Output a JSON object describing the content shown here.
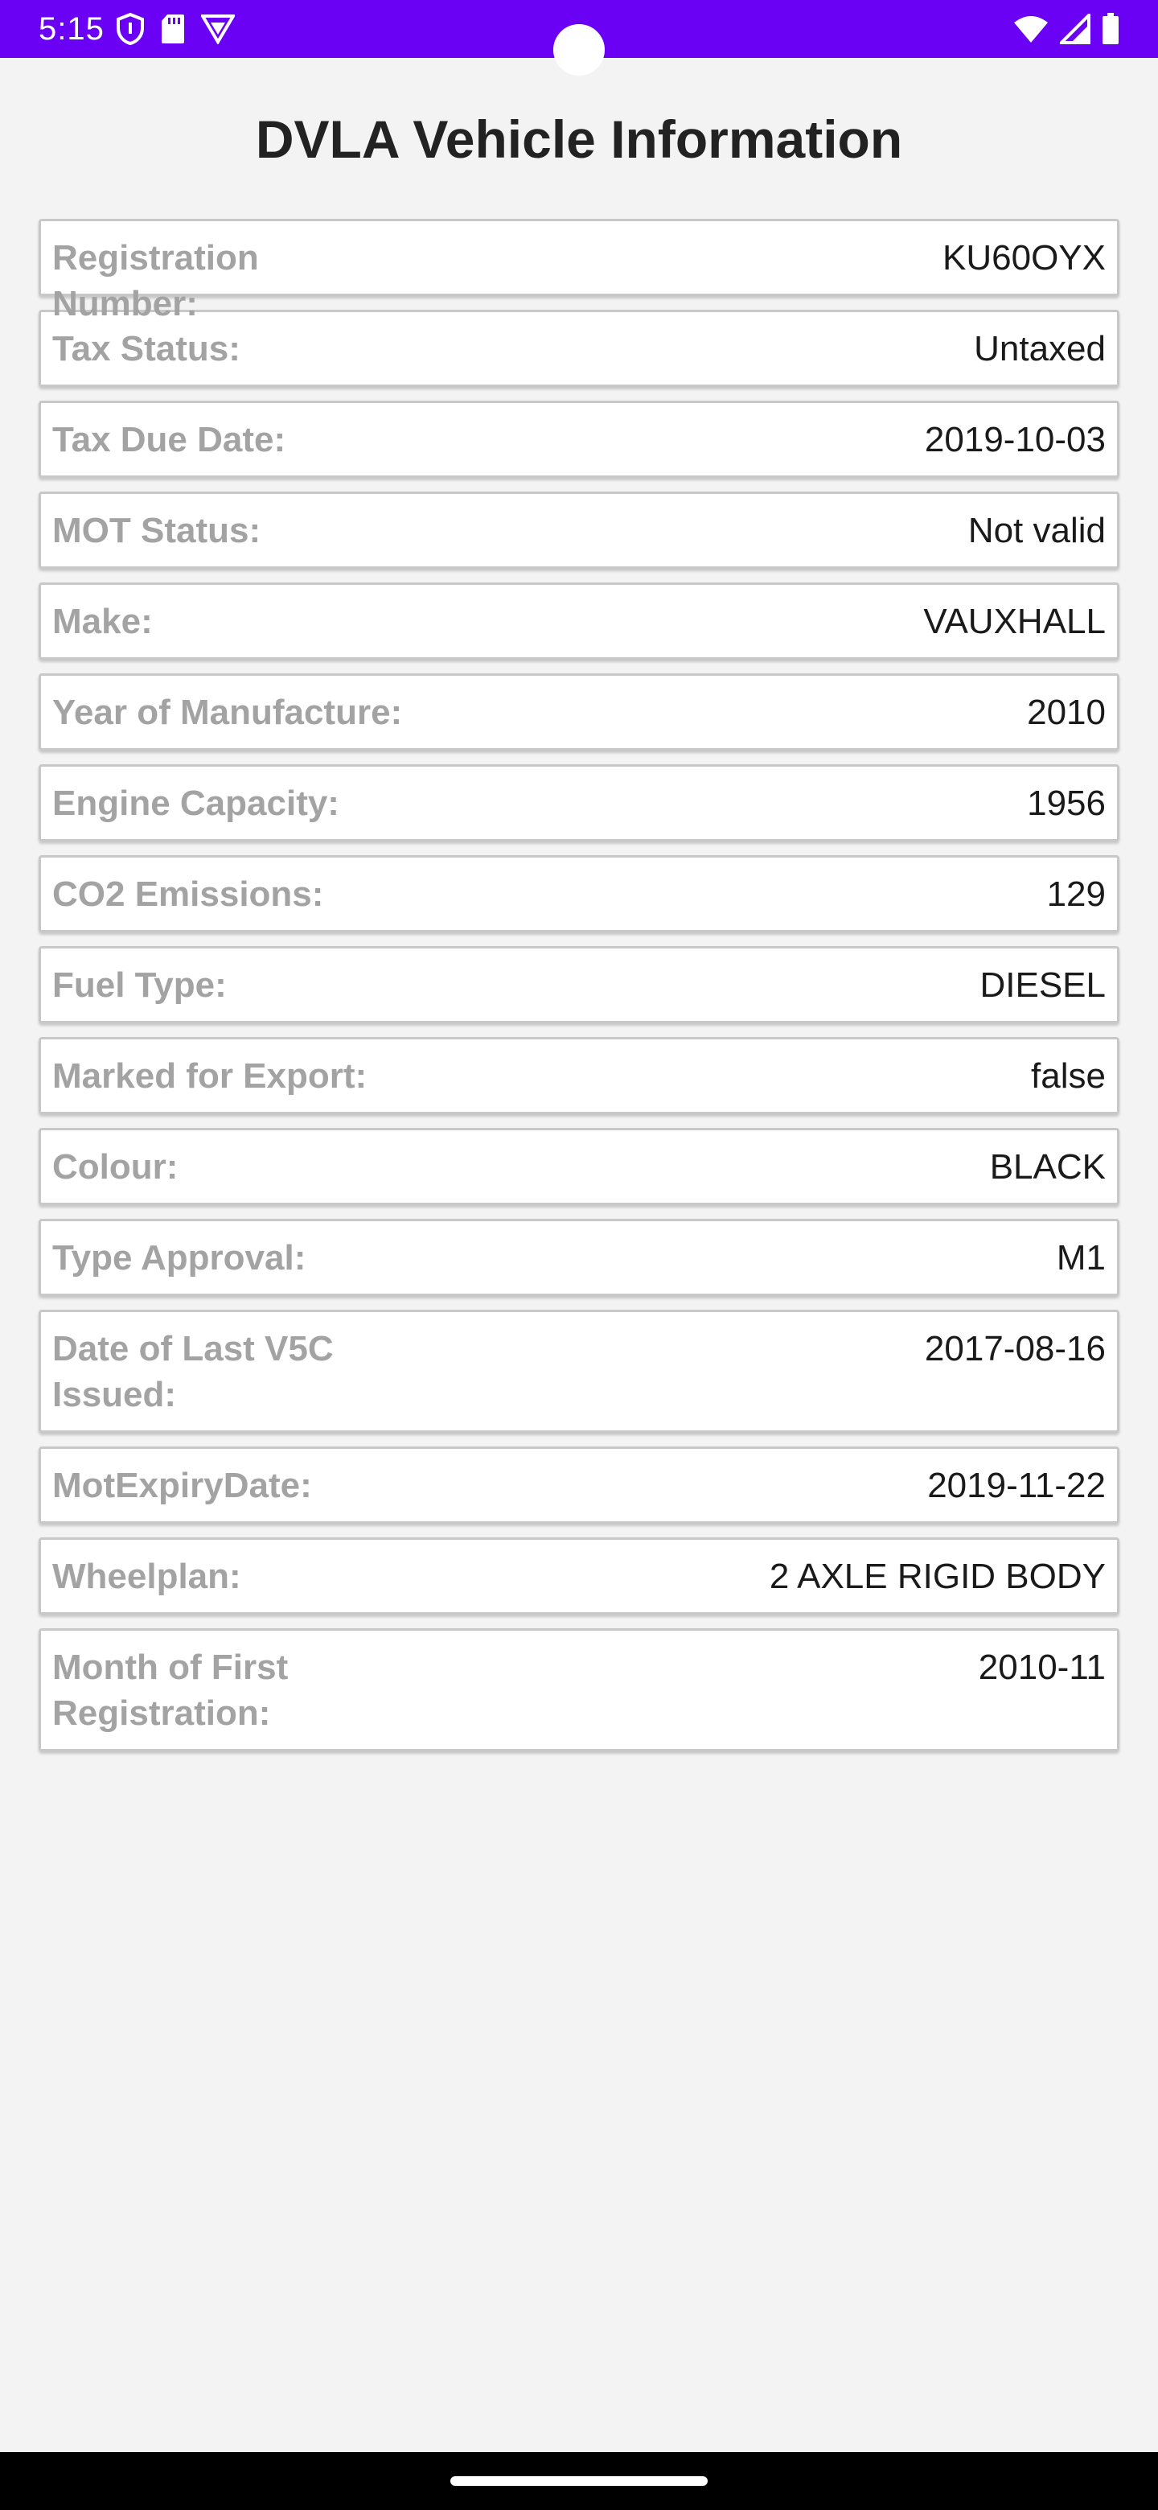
{
  "status_bar": {
    "time": "5:15"
  },
  "page": {
    "title": "DVLA Vehicle Information"
  },
  "rows": [
    {
      "label": "Registration Number:",
      "value": "KU60OYX"
    },
    {
      "label": "Tax Status:",
      "value": "Untaxed"
    },
    {
      "label": "Tax Due Date:",
      "value": "2019-10-03"
    },
    {
      "label": "MOT Status:",
      "value": "Not valid"
    },
    {
      "label": "Make:",
      "value": "VAUXHALL"
    },
    {
      "label": "Year of Manufacture:",
      "value": "2010"
    },
    {
      "label": "Engine Capacity:",
      "value": "1956"
    },
    {
      "label": "CO2 Emissions:",
      "value": "129"
    },
    {
      "label": "Fuel Type:",
      "value": "DIESEL"
    },
    {
      "label": "Marked for Export:",
      "value": "false"
    },
    {
      "label": "Colour:",
      "value": "BLACK"
    },
    {
      "label": "Type Approval:",
      "value": "M1"
    },
    {
      "label": "Date of Last V5C Issued:",
      "value": "2017-08-16"
    },
    {
      "label": "MotExpiryDate:",
      "value": "2019-11-22"
    },
    {
      "label": "Wheelplan:",
      "value": "2 AXLE RIGID BODY"
    },
    {
      "label": "Month of First Registration:",
      "value": "2010-11"
    }
  ],
  "colors": {
    "status_bar": "#6a00f4",
    "background": "#f3f3f3",
    "label": "#a3a3a3",
    "value": "#1a1a1a"
  }
}
